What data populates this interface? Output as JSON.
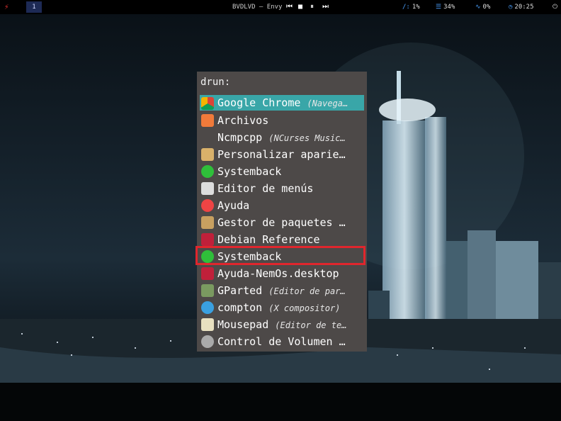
{
  "topbar": {
    "workspace": "1",
    "title": "BVDLVD – Envy",
    "disk_icon": "/:",
    "disk_value": "1%",
    "mem_value": "34%",
    "cpu_value": "0%",
    "clock": "20:25",
    "controls": {
      "prev": "⏮",
      "stop": "■",
      "pause": "⏸",
      "next": "⏭"
    }
  },
  "launcher": {
    "prompt": "drun:",
    "items": [
      {
        "label": "Google Chrome",
        "hint": "(Navega…",
        "icon": "chrome-icon",
        "color": "#e8e8e8"
      },
      {
        "label": "Archivos",
        "hint": "",
        "icon": "folder-icon",
        "color": "#f07a3a"
      },
      {
        "label": "Ncmpcpp",
        "hint": "(NCurses Music…",
        "icon": "none",
        "color": ""
      },
      {
        "label": "Personalizar aparie…",
        "hint": "",
        "icon": "appearance-icon",
        "color": "#d9b16a"
      },
      {
        "label": "Systemback",
        "hint": "",
        "icon": "systemback-icon",
        "color": "#2fbf3a"
      },
      {
        "label": "Editor de menús",
        "hint": "",
        "icon": "menu-editor-icon",
        "color": "#dddddd"
      },
      {
        "label": "Ayuda",
        "hint": "",
        "icon": "help-icon",
        "color": "#e44"
      },
      {
        "label": "Gestor de paquetes …",
        "hint": "",
        "icon": "package-icon",
        "color": "#c8a060"
      },
      {
        "label": "Debian Reference",
        "hint": "",
        "icon": "debian-icon",
        "color": "#c0203a"
      },
      {
        "label": "Systemback",
        "hint": "",
        "icon": "systemback-icon",
        "color": "#2fbf3a"
      },
      {
        "label": "Ayuda-NemOs.desktop",
        "hint": "",
        "icon": "debian-icon",
        "color": "#c0203a"
      },
      {
        "label": "GParted",
        "hint": "(Editor de par…",
        "icon": "gparted-icon",
        "color": "#7a9a60"
      },
      {
        "label": "compton",
        "hint": "(X compositor)",
        "icon": "gear-icon",
        "color": "#3aa0e0"
      },
      {
        "label": "Mousepad",
        "hint": "(Editor de te…",
        "icon": "notepad-icon",
        "color": "#e8e0c0"
      },
      {
        "label": "Control de Volumen …",
        "hint": "",
        "icon": "volume-icon",
        "color": "#aaaaaa"
      }
    ]
  }
}
